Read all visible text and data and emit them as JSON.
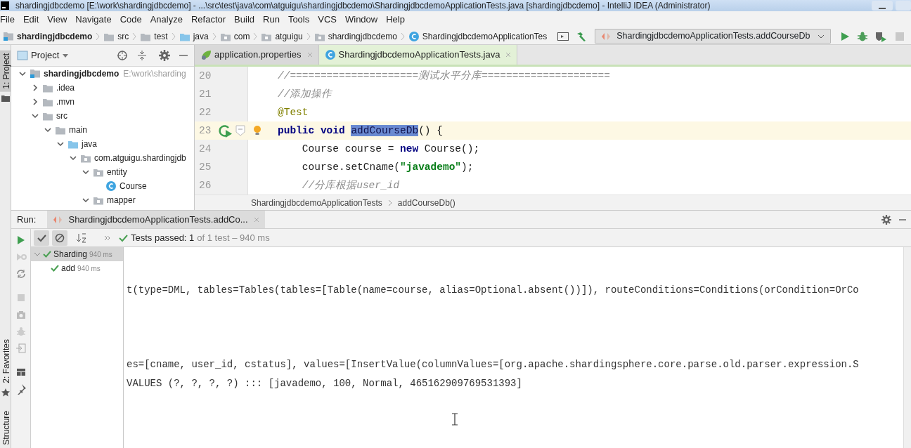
{
  "window": {
    "title": "shardingjdbcdemo [E:\\work\\shardingjdbcdemo] - ...\\src\\test\\java\\com\\atguigu\\shardingjdbcdemo\\ShardingjdbcdemoApplicationTests.java [shardingjdbcdemo] - IntelliJ IDEA (Administrator)"
  },
  "menu": [
    "File",
    "Edit",
    "View",
    "Navigate",
    "Code",
    "Analyze",
    "Refactor",
    "Build",
    "Run",
    "Tools",
    "VCS",
    "Window",
    "Help"
  ],
  "breadcrumbs": [
    {
      "label": "shardingjdbcdemo",
      "kind": "module"
    },
    {
      "label": "src",
      "kind": "folder"
    },
    {
      "label": "test",
      "kind": "folder"
    },
    {
      "label": "java",
      "kind": "source"
    },
    {
      "label": "com",
      "kind": "package"
    },
    {
      "label": "atguigu",
      "kind": "package"
    },
    {
      "label": "shardingjdbcdemo",
      "kind": "package"
    },
    {
      "label": "ShardingjdbcdemoApplicationTes",
      "kind": "class"
    }
  ],
  "run_config": {
    "label": "ShardingjdbcdemoApplicationTests.addCourseDb"
  },
  "side_tabs": [
    {
      "label": "1: Project",
      "selected": true
    },
    {
      "label": "2: Favorites",
      "selected": false
    },
    {
      "label": "Structure",
      "selected": false
    }
  ],
  "project": {
    "title": "Project",
    "tree": [
      {
        "label": "shardingjdbcdemo",
        "path": "E:\\work\\sharding",
        "kind": "module",
        "expanded": true,
        "children": [
          {
            "label": ".idea",
            "kind": "folder",
            "expanded": false
          },
          {
            "label": ".mvn",
            "kind": "folder",
            "expanded": false
          },
          {
            "label": "src",
            "kind": "folder",
            "expanded": true,
            "children": [
              {
                "label": "main",
                "kind": "folder",
                "expanded": true,
                "children": [
                  {
                    "label": "java",
                    "kind": "source",
                    "expanded": true,
                    "children": [
                      {
                        "label": "com.atguigu.shardingjdb",
                        "kind": "package",
                        "expanded": true,
                        "children": [
                          {
                            "label": "entity",
                            "kind": "package",
                            "expanded": true,
                            "children": [
                              {
                                "label": "Course",
                                "kind": "class"
                              }
                            ]
                          },
                          {
                            "label": "mapper",
                            "kind": "package",
                            "expanded": true
                          }
                        ]
                      }
                    ]
                  }
                ]
              }
            ]
          }
        ]
      }
    ]
  },
  "editor": {
    "tabs": [
      {
        "label": "application.properties",
        "kind": "properties",
        "selected": false
      },
      {
        "label": "ShardingjdbcdemoApplicationTests.java",
        "kind": "class",
        "selected": true
      }
    ],
    "lines": [
      {
        "number": "20",
        "current": false,
        "tokens": [
          {
            "kind": "comment",
            "text": "//=====================测试水平分库====================="
          }
        ]
      },
      {
        "number": "21",
        "current": false,
        "tokens": [
          {
            "kind": "comment",
            "text": "//添加操作"
          }
        ]
      },
      {
        "number": "22",
        "current": false,
        "tokens": [
          {
            "kind": "annotation",
            "text": "@Test"
          }
        ]
      },
      {
        "number": "23",
        "current": true,
        "tokens": [
          {
            "kind": "keyword",
            "text": "public void "
          },
          {
            "kind": "selected",
            "text": "addCourseDb"
          },
          {
            "kind": "plain",
            "text": "() {"
          }
        ]
      },
      {
        "number": "24",
        "current": false,
        "tokens": [
          {
            "kind": "plain",
            "text": "    Course course = "
          },
          {
            "kind": "keyword",
            "text": "new "
          },
          {
            "kind": "plain",
            "text": "Course();"
          }
        ]
      },
      {
        "number": "25",
        "current": false,
        "tokens": [
          {
            "kind": "plain",
            "text": "    course.setCname("
          },
          {
            "kind": "string",
            "text": "\"javademo\""
          },
          {
            "kind": "plain",
            "text": ");"
          }
        ]
      },
      {
        "number": "26",
        "current": false,
        "tokens": [
          {
            "kind": "comment",
            "text": "    //分库根据user_id"
          }
        ]
      }
    ],
    "breadcrumb": [
      "ShardingjdbcdemoApplicationTests",
      "addCourseDb()"
    ]
  },
  "run": {
    "label": "Run:",
    "tab": "ShardingjdbcdemoApplicationTests.addCo...",
    "status": "Tests passed: 1",
    "status_detail": "of 1 test – 940 ms",
    "tests": [
      {
        "label": "Sharding",
        "time": "940 ms",
        "passed": true,
        "selected": true,
        "children": [
          {
            "label": "add",
            "time": "940 ms",
            "passed": true,
            "selected": false
          }
        ]
      }
    ],
    "console": [
      "t(type=DML, tables=Tables(tables=[Table(name=course, alias=Optional.absent())]), routeConditions=Conditions(orCondition=OrCo",
      "es=[cname, user_id, cstatus], values=[InsertValue(columnValues=[org.apache.shardingsphere.core.parse.old.parser.expression.S",
      "VALUES (?, ?, ?, ?) ::: [javademo, 100, Normal, 465162909769531393]"
    ]
  }
}
